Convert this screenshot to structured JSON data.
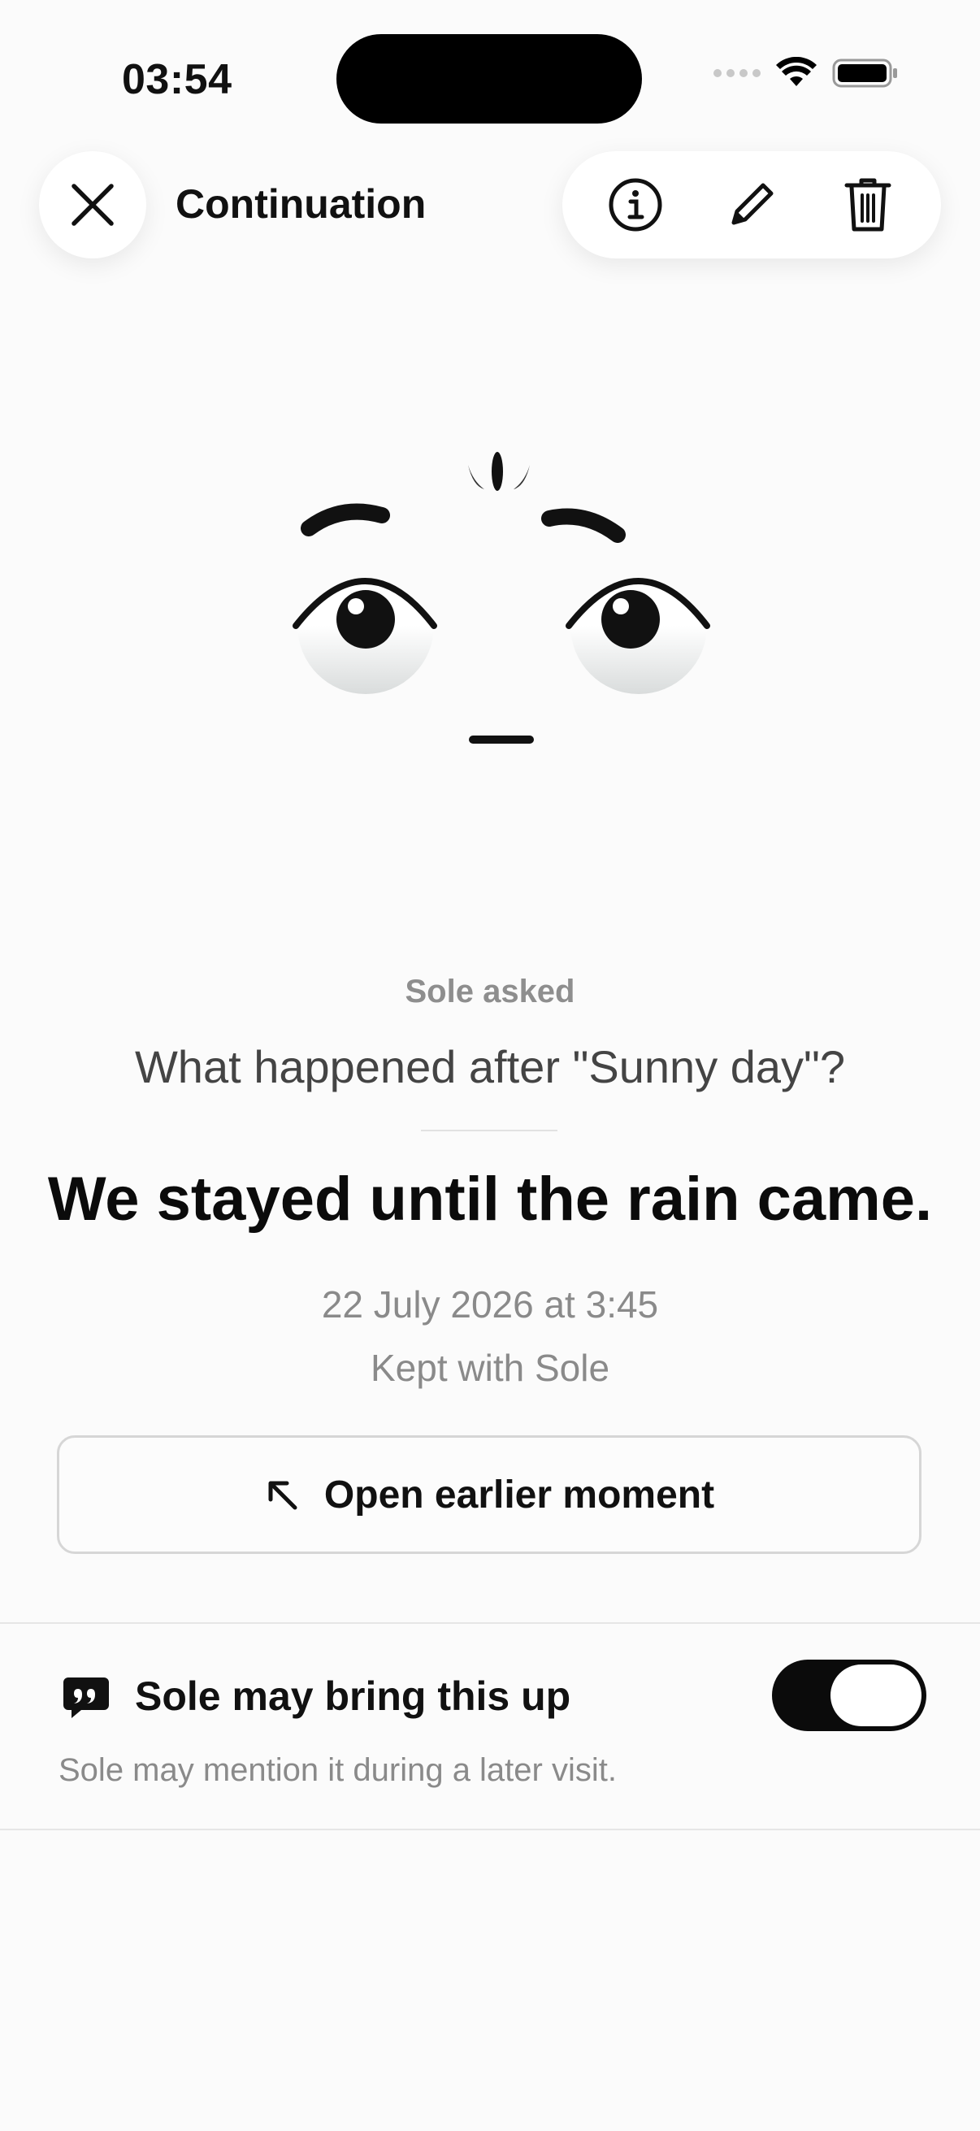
{
  "status_bar": {
    "time": "03:54"
  },
  "header": {
    "title": "Continuation",
    "close_icon": "close-icon",
    "actions": [
      "info-icon",
      "pencil-icon",
      "trash-icon"
    ]
  },
  "entry": {
    "asker": "Sole asked",
    "question": "What happened after \"Sunny day\"?",
    "answer": "We stayed until the rain came.",
    "date": "22 July 2026 at 3:45",
    "kept": "Kept with Sole",
    "open_earlier_label": "Open earlier moment"
  },
  "setting": {
    "label": "Sole may bring this up",
    "help": "Sole may mention it during a later visit.",
    "enabled": true
  },
  "colors": {
    "accent": "#0b0b0b",
    "muted": "#8a8a8a",
    "background": "#fbfbfb"
  }
}
